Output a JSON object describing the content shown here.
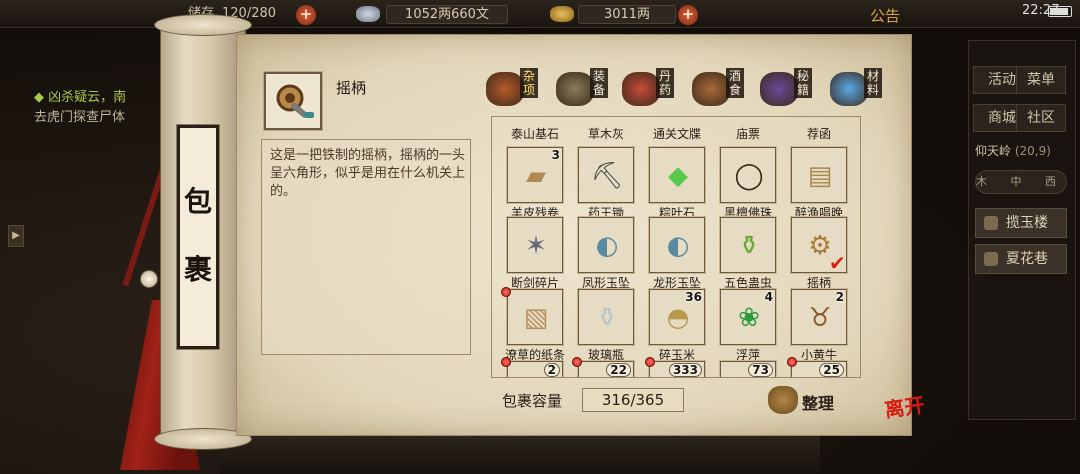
{
  "topbar": {
    "storage_label": "储存",
    "storage_value": "120/280",
    "silver": "1052两660文",
    "gold": "3011两",
    "notice": "公告",
    "time": "22:27"
  },
  "quest": {
    "title": "◆ 凶杀疑云，南",
    "detail": "去虎门探查尸体"
  },
  "right_panel": {
    "buttons": [
      "活动",
      "菜单",
      "商城",
      "社区"
    ],
    "location": "仰天岭",
    "coord": "(20,9)",
    "view_tabs": "木 中 西",
    "places": [
      "揽玉楼",
      "夏花巷"
    ]
  },
  "scroll": {
    "tag_chars": [
      "包",
      "裹"
    ]
  },
  "selected_item": {
    "name": "摇柄",
    "description": "这是一把铁制的摇柄，摇柄的一头呈六角形，似乎是用在什么机关上的。"
  },
  "categories": [
    {
      "label": "杂项",
      "icon": "jar-icon",
      "active": true
    },
    {
      "label": "装备",
      "icon": "weapon-icon",
      "active": false
    },
    {
      "label": "丹药",
      "icon": "pills-icon",
      "active": false
    },
    {
      "label": "酒食",
      "icon": "wine-food-icon",
      "active": false
    },
    {
      "label": "秘籍",
      "icon": "book-icon",
      "active": false
    },
    {
      "label": "材料",
      "icon": "crystal-icon",
      "active": false
    }
  ],
  "partial_row_top": [
    "泰山基石",
    "草木灰",
    "通关文牒",
    "庙票",
    "荐函"
  ],
  "rows": [
    [
      {
        "name": "羊皮残卷",
        "count": "3",
        "icon": "scroll-icon"
      },
      {
        "name": "药王锄",
        "count": "",
        "icon": "hoe-icon"
      },
      {
        "name": "粽叶石",
        "count": "",
        "icon": "green-stone-icon"
      },
      {
        "name": "黑檀佛珠",
        "count": "",
        "icon": "beads-icon"
      },
      {
        "name": "醉渔唱晚",
        "count": "",
        "icon": "book-icon"
      }
    ],
    [
      {
        "name": "断剑碎片",
        "count": "",
        "icon": "shards-icon"
      },
      {
        "name": "凤形玉坠",
        "count": "",
        "icon": "jade-pendant-icon"
      },
      {
        "name": "龙形玉坠",
        "count": "",
        "icon": "jade-pendant-icon"
      },
      {
        "name": "五色蛊虫",
        "count": "",
        "icon": "bottle-icon"
      },
      {
        "name": "摇柄",
        "count": "",
        "icon": "crank-icon",
        "selected": true
      }
    ],
    [
      {
        "name": "潦草的纸条",
        "count": "",
        "icon": "paper-icon"
      },
      {
        "name": "玻璃瓶",
        "count": "",
        "icon": "glass-bottle-icon"
      },
      {
        "name": "碎玉米",
        "count": "36",
        "icon": "grain-sack-icon"
      },
      {
        "name": "浮萍",
        "count": "4",
        "icon": "duckweed-icon"
      },
      {
        "name": "小黄牛",
        "count": "2",
        "icon": "ox-icon"
      }
    ]
  ],
  "partial_row_bottom": [
    "2",
    "22",
    "333",
    "73",
    "25"
  ],
  "capacity": {
    "label": "包裹容量",
    "value": "316/365"
  },
  "sort_label": "整理",
  "leave_label": "离开",
  "colors": {
    "paper": "#e6dcc4",
    "accent_red": "#d81c10",
    "active_tab": "#ffe070"
  }
}
